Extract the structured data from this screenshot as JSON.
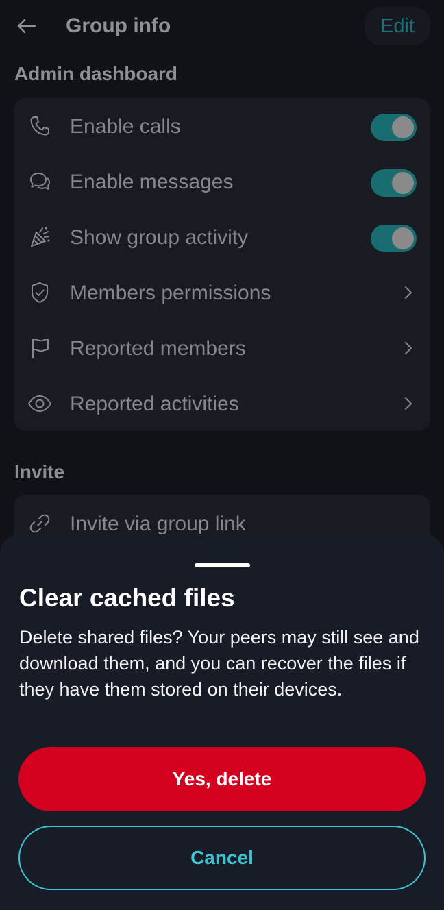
{
  "header": {
    "title": "Group info",
    "edit_label": "Edit"
  },
  "admin": {
    "section_title": "Admin dashboard",
    "items": [
      {
        "label": "Enable calls",
        "icon": "phone-icon",
        "control": "toggle",
        "on": true
      },
      {
        "label": "Enable messages",
        "icon": "chat-bubbles-icon",
        "control": "toggle",
        "on": true
      },
      {
        "label": "Show group activity",
        "icon": "party-popper-icon",
        "control": "toggle",
        "on": true
      },
      {
        "label": "Members permissions",
        "icon": "shield-check-icon",
        "control": "chevron"
      },
      {
        "label": "Reported members",
        "icon": "flag-icon",
        "control": "chevron"
      },
      {
        "label": "Reported activities",
        "icon": "eye-icon",
        "control": "chevron"
      }
    ]
  },
  "invite": {
    "section_title": "Invite",
    "items": [
      {
        "label": "Invite via group link",
        "icon": "link-icon"
      }
    ]
  },
  "sheet": {
    "title": "Clear cached files",
    "body": "Delete shared files? Your peers may still see and download them, and you can recover the files if they have them stored on their devices.",
    "confirm_label": "Yes, delete",
    "cancel_label": "Cancel"
  },
  "colors": {
    "background": "#101217",
    "sheet": "#181c26",
    "danger": "#d4001f",
    "accent": "#3ec3d2",
    "toggle_on": "#196c70"
  }
}
